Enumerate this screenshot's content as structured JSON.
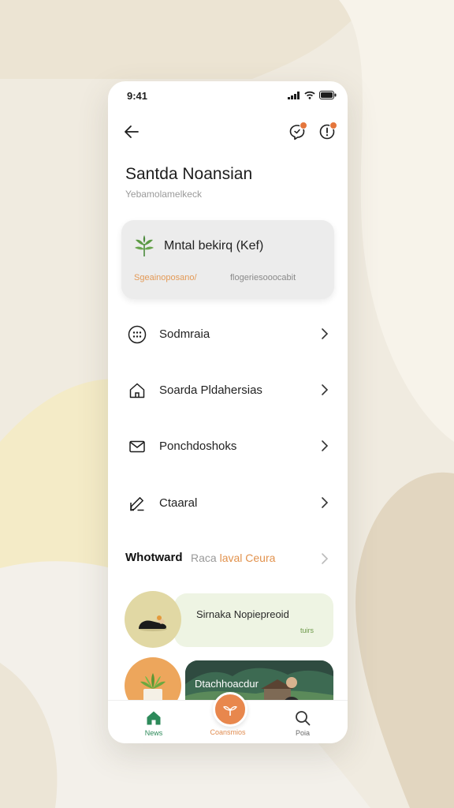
{
  "colors": {
    "accent_orange": "#e8874d",
    "accent_green": "#2d8a5a",
    "card_bg": "#ececec",
    "feature_green_bg": "#eef4e3"
  },
  "status_bar": {
    "time": "9:41"
  },
  "header": {
    "back_icon": "arrow-left-icon",
    "icons": [
      "chat-bubble-icon",
      "notification-icon"
    ]
  },
  "profile": {
    "title": "Santda Noansian",
    "subtitle": "Yebamolamelkeck"
  },
  "card": {
    "icon": "leaf-icon",
    "title": "Mntal bekirq (Kef)",
    "tag_orange": "Sgeainoposano/",
    "tag_grey": "flogeriesooocabit"
  },
  "menu": [
    {
      "label": "Sodmraia",
      "icon": "grid-dots-icon"
    },
    {
      "label": "Soarda Pldahersias",
      "icon": "home-icon"
    },
    {
      "label": "Ponchdoshoks",
      "icon": "envelope-icon"
    },
    {
      "label": "Ctaaral",
      "icon": "edit-pen-icon"
    }
  ],
  "section": {
    "title": "Whotward",
    "link_prefix": "Raca",
    "link_accent": "laval Ceura"
  },
  "features": [
    {
      "title": "Sirnaka Nopiepreoid",
      "meta": "tuirs"
    },
    {
      "title": "Dtachhoacdur"
    }
  ],
  "tabbar": [
    {
      "label": "News",
      "icon": "home-icon",
      "color": "#2d8a5a"
    },
    {
      "label": "Coansmios",
      "icon": "leaf-icon",
      "color": "#e08c50"
    },
    {
      "label": "Poia",
      "icon": "search-icon",
      "color": "#6a6a6a"
    }
  ]
}
